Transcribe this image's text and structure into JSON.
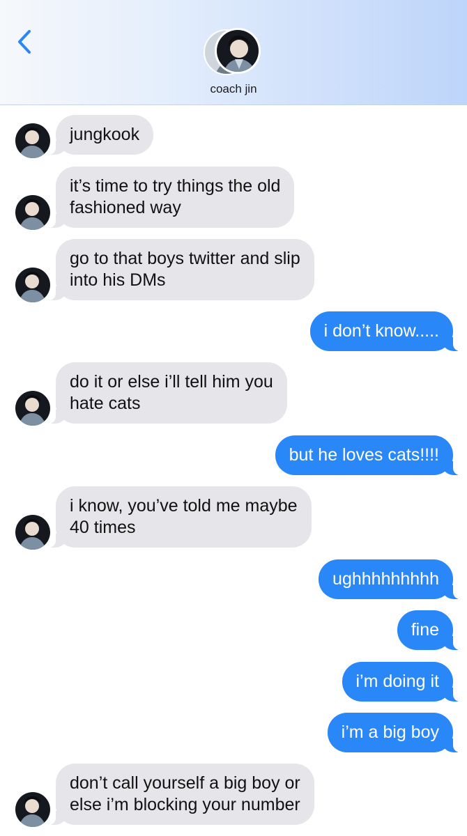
{
  "header": {
    "contact_name": "coach jin",
    "back_icon": "chevron-left-icon",
    "accent_color": "#2a87f7"
  },
  "messages": [
    {
      "sender": "coach",
      "lines": [
        "jungkook"
      ]
    },
    {
      "sender": "coach",
      "lines": [
        "it’s time to try things the old",
        "fashioned way"
      ]
    },
    {
      "sender": "coach",
      "lines": [
        "go to that boys twitter and slip",
        "into his DMs"
      ]
    },
    {
      "sender": "me",
      "lines": [
        "i don’t know....."
      ]
    },
    {
      "sender": "coach",
      "lines": [
        "do it or else i’ll tell him you",
        "hate cats"
      ]
    },
    {
      "sender": "me",
      "lines": [
        "but he loves cats!!!!"
      ]
    },
    {
      "sender": "coach",
      "lines": [
        "i know, you’ve told me maybe",
        "40 times"
      ]
    },
    {
      "sender": "me",
      "lines": [
        "ughhhhhhhhh"
      ]
    },
    {
      "sender": "me",
      "lines": [
        "fine"
      ]
    },
    {
      "sender": "me",
      "lines": [
        "i’m doing it"
      ]
    },
    {
      "sender": "me",
      "lines": [
        "i’m a big boy"
      ]
    },
    {
      "sender": "coach",
      "lines": [
        "don’t call yourself a big boy or",
        "else i’m blocking your number"
      ]
    }
  ]
}
